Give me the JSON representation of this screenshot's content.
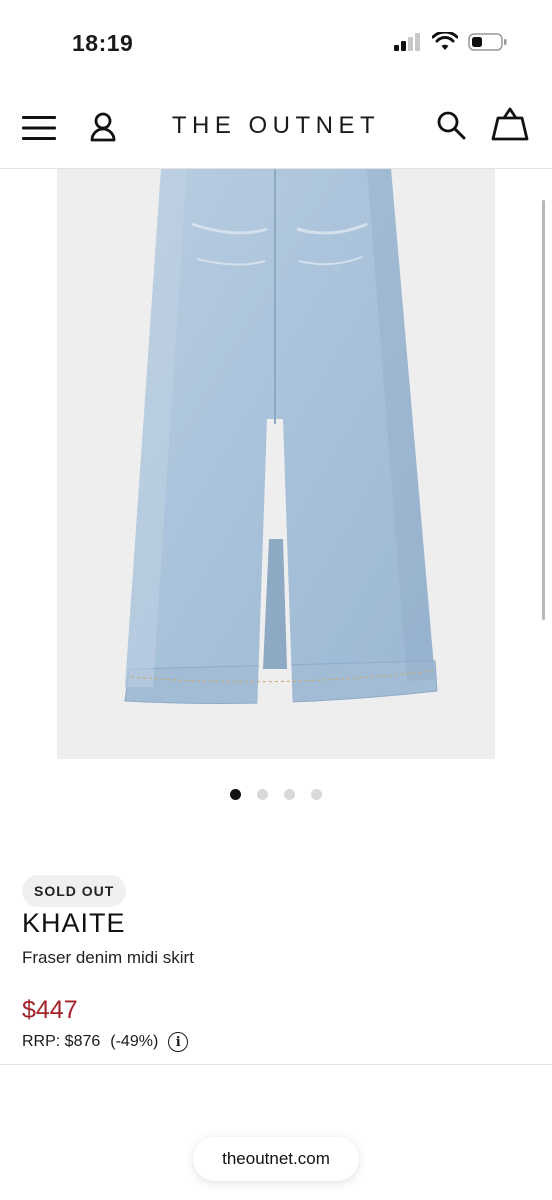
{
  "status_bar": {
    "time": "18:19",
    "icons": [
      "cellular-signal-icon",
      "wifi-icon",
      "battery-icon"
    ]
  },
  "header": {
    "brand": "THE OUTNET",
    "icons": [
      "menu-icon",
      "account-icon",
      "search-icon",
      "bag-icon"
    ]
  },
  "gallery": {
    "image": "light-wash denim midi skirt with front slit",
    "total_images": 4,
    "active_index": 0
  },
  "product": {
    "status_badge": "SOLD OUT",
    "designer": "KHAITE",
    "name": "Fraser denim midi skirt",
    "price": "$447",
    "rrp": "RRP: $876",
    "discount": "(-49%)"
  },
  "browser": {
    "url": "theoutnet.com"
  },
  "colors": {
    "price": "#a3232b",
    "badge_bg": "#f0f0f0",
    "gallery_bg": "#eeeeee"
  }
}
